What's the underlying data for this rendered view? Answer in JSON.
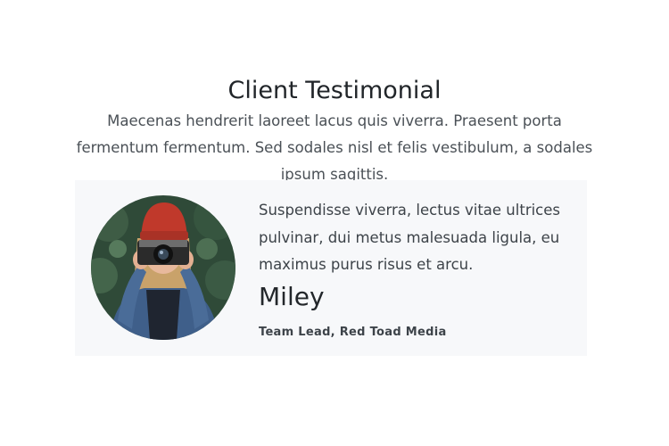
{
  "testimonial_section": {
    "heading": "Client Testimonial",
    "intro": "Maecenas hendrerit laoreet lacus quis viverra. Praesent porta fermentum fermentum. Sed sodales nisl et felis vestibulum, a sodales ipsum sagittis.",
    "card": {
      "photo_description": "client-photo",
      "quote": "Suspendisse viverra, lectus vitae ultrices pulvinar, dui metus malesuada ligula, eu maximus purus risus et arcu.",
      "name": "Miley",
      "role": "Team Lead, Red Toad Media"
    }
  },
  "colors": {
    "card_background": "#f7f8fa",
    "heading_text": "#212529",
    "body_text": "#4a5056"
  }
}
